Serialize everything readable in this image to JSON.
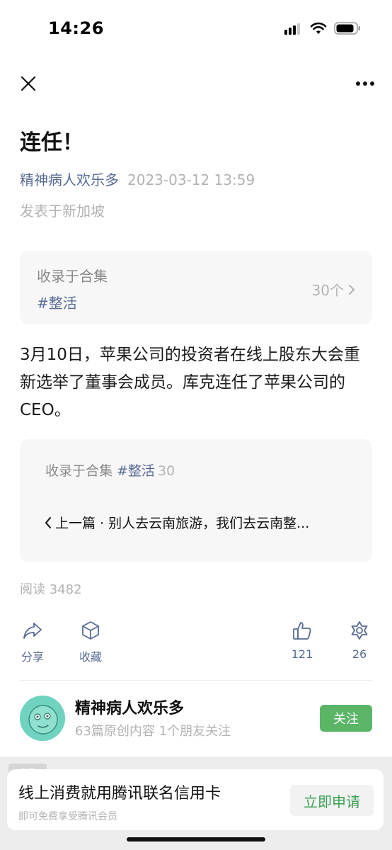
{
  "status_bar": {
    "time": "14:26"
  },
  "article": {
    "title": "连任！",
    "author": "精神病人欢乐多",
    "date": "2023-03-12 13:59",
    "location": "发表于新加坡",
    "body": "3月10日，苹果公司的投资者在线上股东大会重新选举了董事会成员。库克连任了苹果公司的CEO。"
  },
  "collection_card": {
    "label": "收录于合集",
    "tag": "#整活",
    "count": "30个"
  },
  "series_card": {
    "label": "收录于合集",
    "tag": "#整活",
    "count": "30",
    "prev_label": "上一篇 · 别人去云南旅游，我们去云南整..."
  },
  "read_count": "阅读 3482",
  "actions": {
    "share": "分享",
    "collect": "收藏",
    "like_count": "121",
    "wow_count": "26"
  },
  "author_card": {
    "name": "精神病人欢乐多",
    "stats": "63篇原创内容  1个朋友关注",
    "follow_label": "关注"
  },
  "ad": {
    "badge": "广告",
    "title": "线上消费就用腾讯联名信用卡",
    "subtitle": "即可免费享受腾讯会员",
    "button": "立即申请"
  },
  "colors": {
    "link": "#576b95",
    "accent_green": "#5ab567",
    "muted": "#b2b2b2"
  }
}
